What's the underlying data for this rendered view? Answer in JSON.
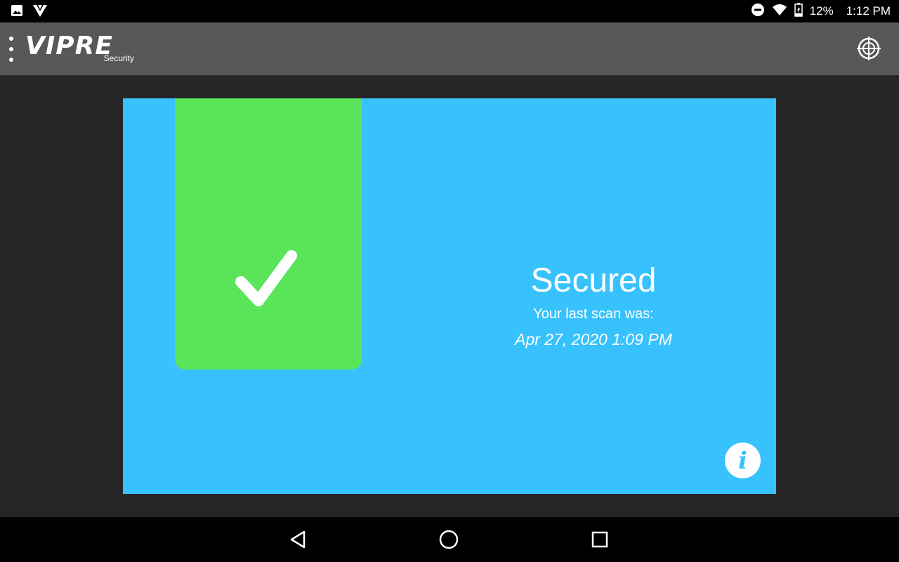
{
  "status_bar": {
    "battery": "12%",
    "time": "1:12 PM",
    "icons": [
      "image-icon",
      "vipre-icon",
      "do-not-disturb-icon",
      "wifi-icon",
      "battery-icon"
    ]
  },
  "app_bar": {
    "brand": "VIPRE",
    "brand_sub": "Security",
    "icons": [
      "overflow-menu-icon",
      "crosshair-icon"
    ]
  },
  "card": {
    "title": "Secured",
    "subtitle": "Your last scan was:",
    "last_scan": "Apr 27, 2020 1:09 PM",
    "info_glyph": "i",
    "colors": {
      "background": "#38c2fd",
      "status_tile": "#5ae45a"
    }
  },
  "nav_bar": {
    "icons": [
      "back-icon",
      "home-icon",
      "recents-icon"
    ]
  }
}
